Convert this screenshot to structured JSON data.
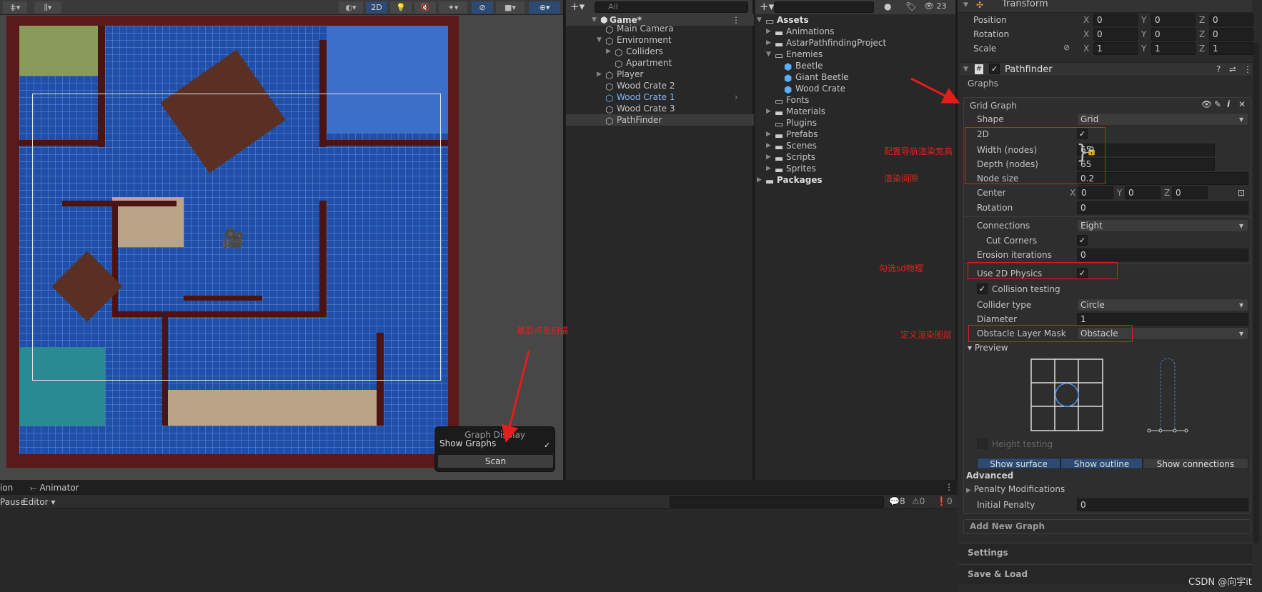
{
  "scene": {
    "toolbar": {
      "two_d": "2D"
    },
    "graph_display": {
      "title": "Graph Display",
      "show_graphs": "Show Graphs",
      "show_graphs_checked": true,
      "scan": "Scan"
    }
  },
  "hierarchy": {
    "search_placeholder": "All",
    "root": "Game*",
    "items": [
      {
        "label": "Main Camera",
        "depth": 1,
        "fold": ""
      },
      {
        "label": "Environment",
        "depth": 1,
        "fold": "open"
      },
      {
        "label": "Colliders",
        "depth": 2,
        "fold": "closed"
      },
      {
        "label": "Apartment",
        "depth": 2,
        "fold": ""
      },
      {
        "label": "Player",
        "depth": 1,
        "fold": "closed"
      },
      {
        "label": "Wood Crate 2",
        "depth": 1,
        "fold": ""
      },
      {
        "label": "Wood Crate 1",
        "depth": 1,
        "fold": "",
        "prefab": true
      },
      {
        "label": "Wood Crate 3",
        "depth": 1,
        "fold": ""
      },
      {
        "label": "PathFinder",
        "depth": 1,
        "fold": "",
        "selected": true
      }
    ]
  },
  "project": {
    "hidden_count": "23",
    "items": [
      {
        "label": "Assets",
        "depth": 0,
        "fold": "open",
        "kind": "folder-open",
        "bold": true
      },
      {
        "label": "Animations",
        "depth": 1,
        "fold": "closed",
        "kind": "folder"
      },
      {
        "label": "AstarPathfindingProject",
        "depth": 1,
        "fold": "closed",
        "kind": "folder"
      },
      {
        "label": "Enemies",
        "depth": 1,
        "fold": "open",
        "kind": "folder-open"
      },
      {
        "label": "Beetle",
        "depth": 2,
        "fold": "",
        "kind": "prefab"
      },
      {
        "label": "Giant Beetle",
        "depth": 2,
        "fold": "",
        "kind": "prefab"
      },
      {
        "label": "Wood Crate",
        "depth": 2,
        "fold": "",
        "kind": "prefab"
      },
      {
        "label": "Fonts",
        "depth": 1,
        "fold": "",
        "kind": "folder-empty"
      },
      {
        "label": "Materials",
        "depth": 1,
        "fold": "closed",
        "kind": "folder"
      },
      {
        "label": "Plugins",
        "depth": 1,
        "fold": "",
        "kind": "folder-empty"
      },
      {
        "label": "Prefabs",
        "depth": 1,
        "fold": "closed",
        "kind": "folder"
      },
      {
        "label": "Scenes",
        "depth": 1,
        "fold": "closed",
        "kind": "folder"
      },
      {
        "label": "Scripts",
        "depth": 1,
        "fold": "closed",
        "kind": "folder"
      },
      {
        "label": "Sprites",
        "depth": 1,
        "fold": "closed",
        "kind": "folder"
      },
      {
        "label": "Packages",
        "depth": 0,
        "fold": "closed",
        "kind": "folder",
        "bold": true
      }
    ]
  },
  "inspector": {
    "transform": {
      "title": "Transform",
      "rows": [
        {
          "label": "Position",
          "x": "0",
          "y": "0",
          "z": "0"
        },
        {
          "label": "Rotation",
          "x": "0",
          "y": "0",
          "z": "0"
        },
        {
          "label": "Scale",
          "x": "1",
          "y": "1",
          "z": "1"
        }
      ]
    },
    "pathfinder": {
      "title": "Pathfinder",
      "enabled": true,
      "graphs": "Graphs"
    },
    "grid_graph": {
      "title": "Grid Graph",
      "fields": [
        {
          "type": "dropdown",
          "label": "Shape",
          "value": "Grid"
        },
        {
          "type": "check",
          "label": "2D",
          "value": true
        },
        {
          "type": "input",
          "label": "Width (nodes)",
          "value": "65",
          "short": true
        },
        {
          "type": "input",
          "label": "Depth (nodes)",
          "value": "65",
          "short": true
        },
        {
          "type": "input",
          "label": "Node size",
          "value": "0.2"
        },
        {
          "type": "xyz",
          "label": "Center",
          "x": "0",
          "y": "0",
          "z": "0"
        },
        {
          "type": "input",
          "label": "Rotation",
          "value": "0"
        },
        {
          "type": "dropdown",
          "label": "Connections",
          "value": "Eight"
        },
        {
          "type": "check",
          "label": "Cut Corners",
          "value": true,
          "indent": true
        },
        {
          "type": "input",
          "label": "Erosion iterations",
          "value": "0"
        },
        {
          "type": "check",
          "label": "Use 2D Physics",
          "value": true
        },
        {
          "type": "leadcheck",
          "label": "Collision testing",
          "value": true
        },
        {
          "type": "dropdown",
          "label": "Collider type",
          "value": "Circle"
        },
        {
          "type": "input",
          "label": "Diameter",
          "value": "1"
        },
        {
          "type": "dropdown",
          "label": "Obstacle Layer Mask",
          "value": "Obstacle"
        },
        {
          "type": "foldout",
          "label": "Preview"
        },
        {
          "type": "leadcheck",
          "label": "Height testing",
          "value": false,
          "disabled": true
        }
      ],
      "display_buttons": [
        {
          "label": "Show surface",
          "active": true
        },
        {
          "label": "Show outline",
          "active": true
        },
        {
          "label": "Show connections",
          "active": false
        }
      ],
      "advanced": "Advanced",
      "penalty_mod": "Penalty Modifications",
      "initial_penalty": {
        "label": "Initial Penalty",
        "value": "0"
      }
    },
    "add_new_graph": "Add New Graph",
    "settings": "Settings",
    "save_load": "Save & Load"
  },
  "bottom": {
    "tab_partial": "ion",
    "tab_animator": "Animator",
    "pause": "Pause",
    "editor": "Editor",
    "log_count": "8",
    "warn_count": "0",
    "error_count": "0"
  },
  "annotations": {
    "size": "配置导航渲染宽高",
    "gap": "渲染间隙",
    "physics": "勾选sd物理",
    "layer": "定义渲染图层",
    "scan": "最后点击扫描"
  },
  "watermark": "CSDN @向宇it",
  "colors": {
    "accent": "#2d4a73",
    "annotation": "#e31c1c",
    "graph_blue": "#1f4fa8"
  }
}
